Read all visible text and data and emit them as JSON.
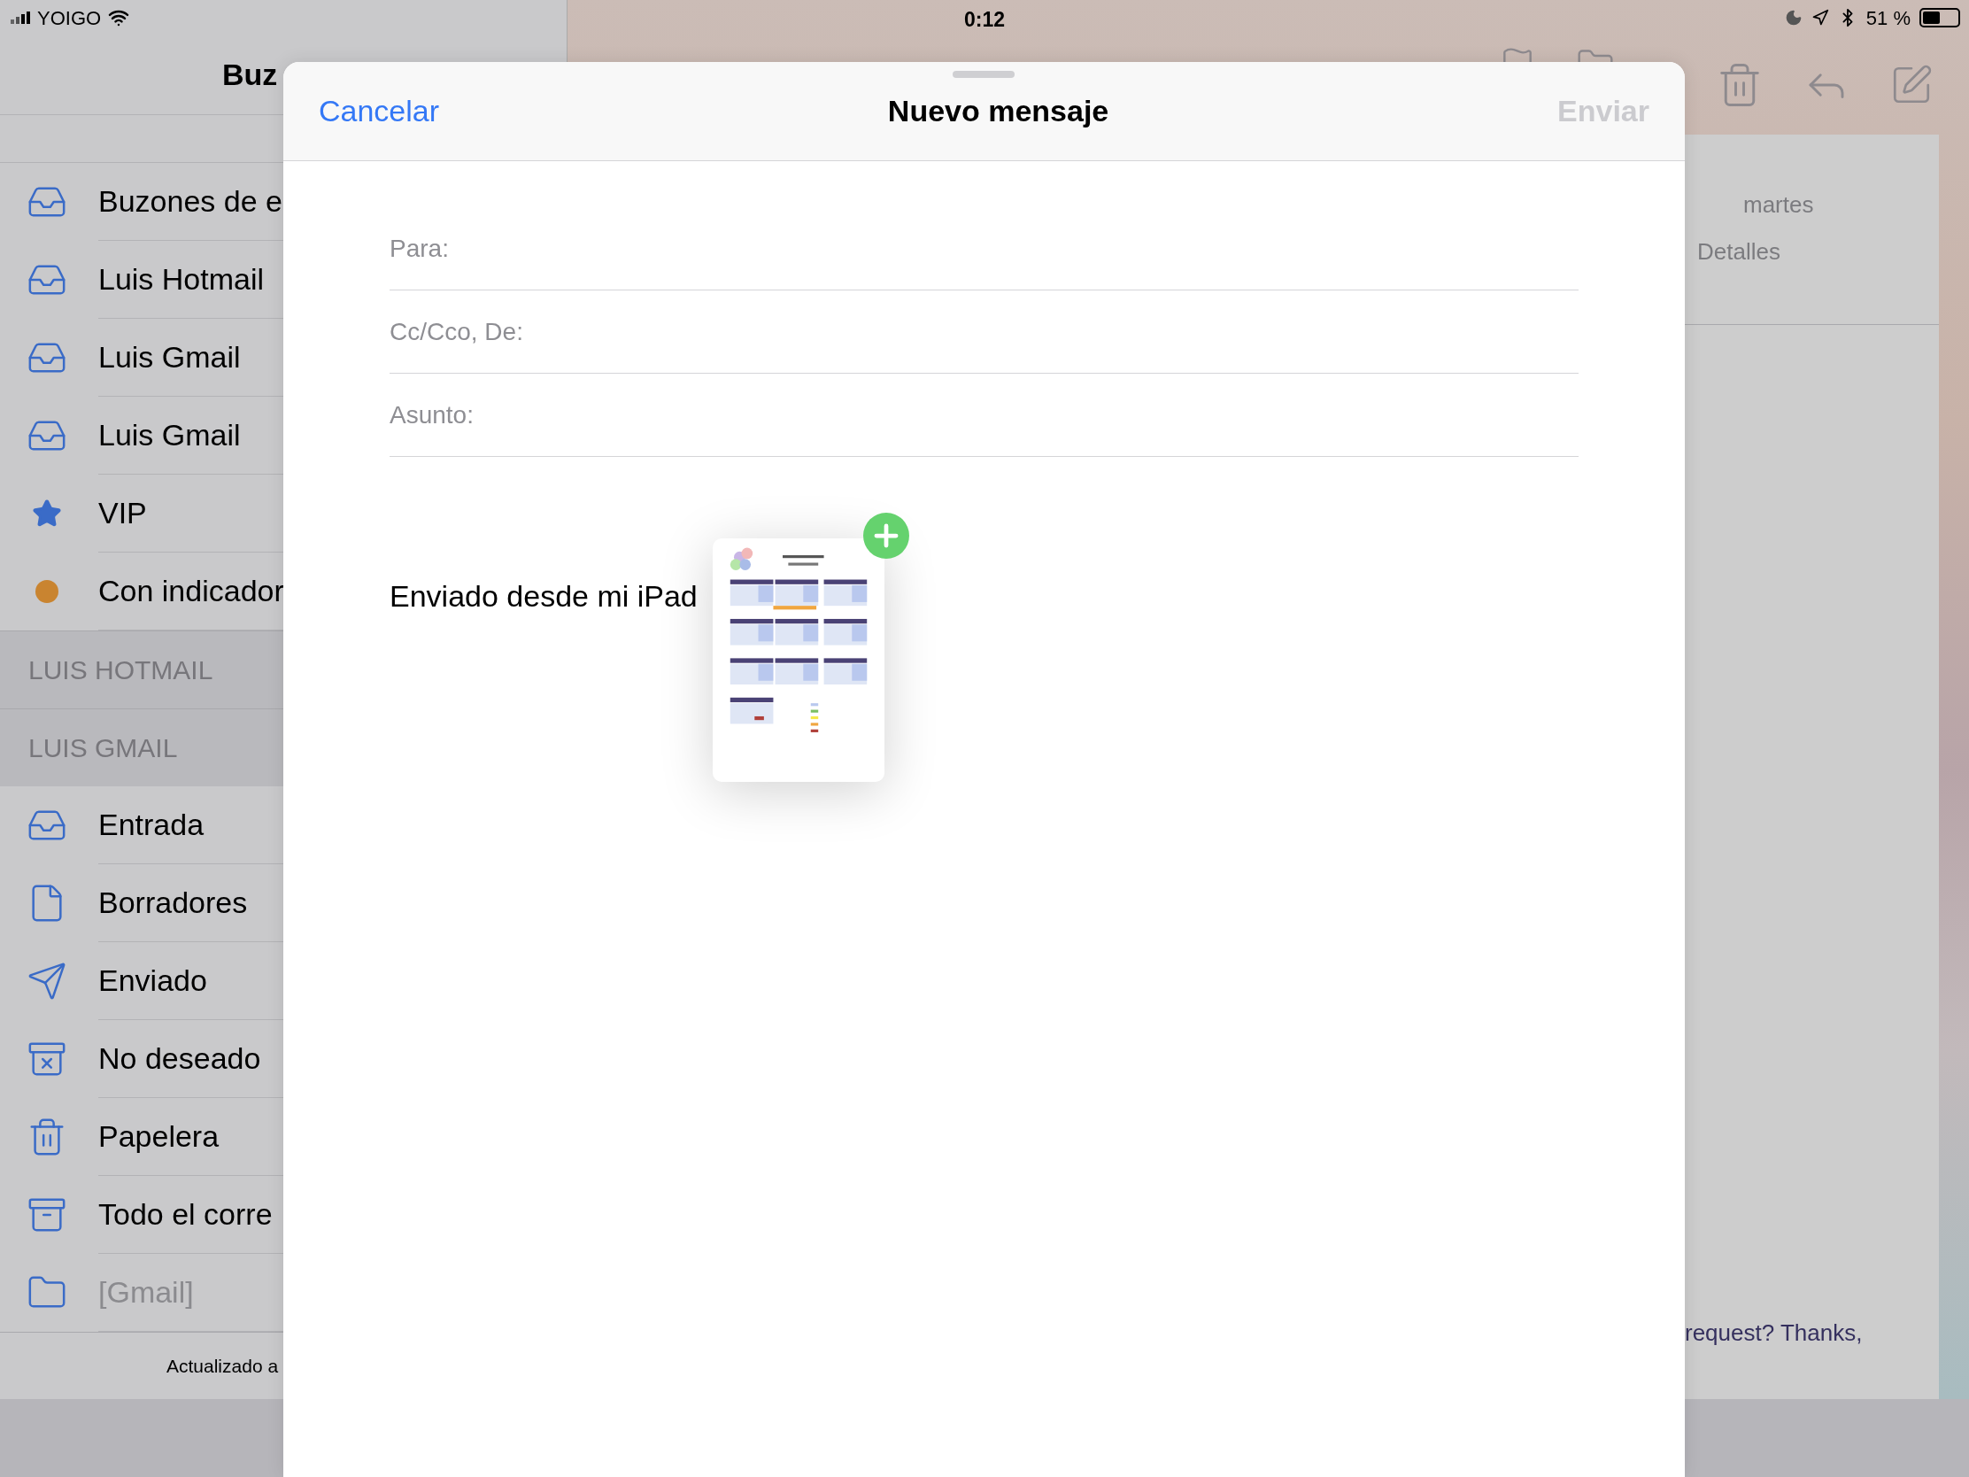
{
  "status_bar": {
    "carrier": "YOIGO",
    "time": "0:12",
    "battery": "51 %"
  },
  "sidebar": {
    "title": "Buz",
    "items": [
      {
        "kind": "mailboxes",
        "label": "Buzones de e"
      },
      {
        "kind": "inbox",
        "label": "Luis Hotmail"
      },
      {
        "kind": "inbox",
        "label": "Luis Gmail"
      },
      {
        "kind": "inbox",
        "label": "Luis Gmail"
      },
      {
        "kind": "star",
        "label": "VIP"
      },
      {
        "kind": "dot",
        "label": "Con indicador"
      },
      {
        "kind": "header",
        "label": "LUIS HOTMAIL"
      },
      {
        "kind": "header",
        "label": "LUIS GMAIL"
      },
      {
        "kind": "inbox",
        "label": "Entrada"
      },
      {
        "kind": "draft",
        "label": "Borradores"
      },
      {
        "kind": "sent",
        "label": "Enviado"
      },
      {
        "kind": "junk",
        "label": "No deseado"
      },
      {
        "kind": "trash",
        "label": "Papelera"
      },
      {
        "kind": "archive",
        "label": "Todo el corre"
      },
      {
        "kind": "folder",
        "label": "[Gmail]",
        "dimmed": true
      }
    ],
    "footer": "Actualizado a"
  },
  "detail": {
    "date": "martes",
    "details_link": "Detalles",
    "snippet": "request? Thanks,"
  },
  "compose": {
    "cancel": "Cancelar",
    "title": "Nuevo mensaje",
    "send": "Enviar",
    "send_disabled": true,
    "fields": [
      {
        "label": "Para:"
      },
      {
        "label": "Cc/Cco, De:"
      },
      {
        "label": "Asunto:"
      }
    ],
    "signature": "Enviado desde mi iPad"
  }
}
